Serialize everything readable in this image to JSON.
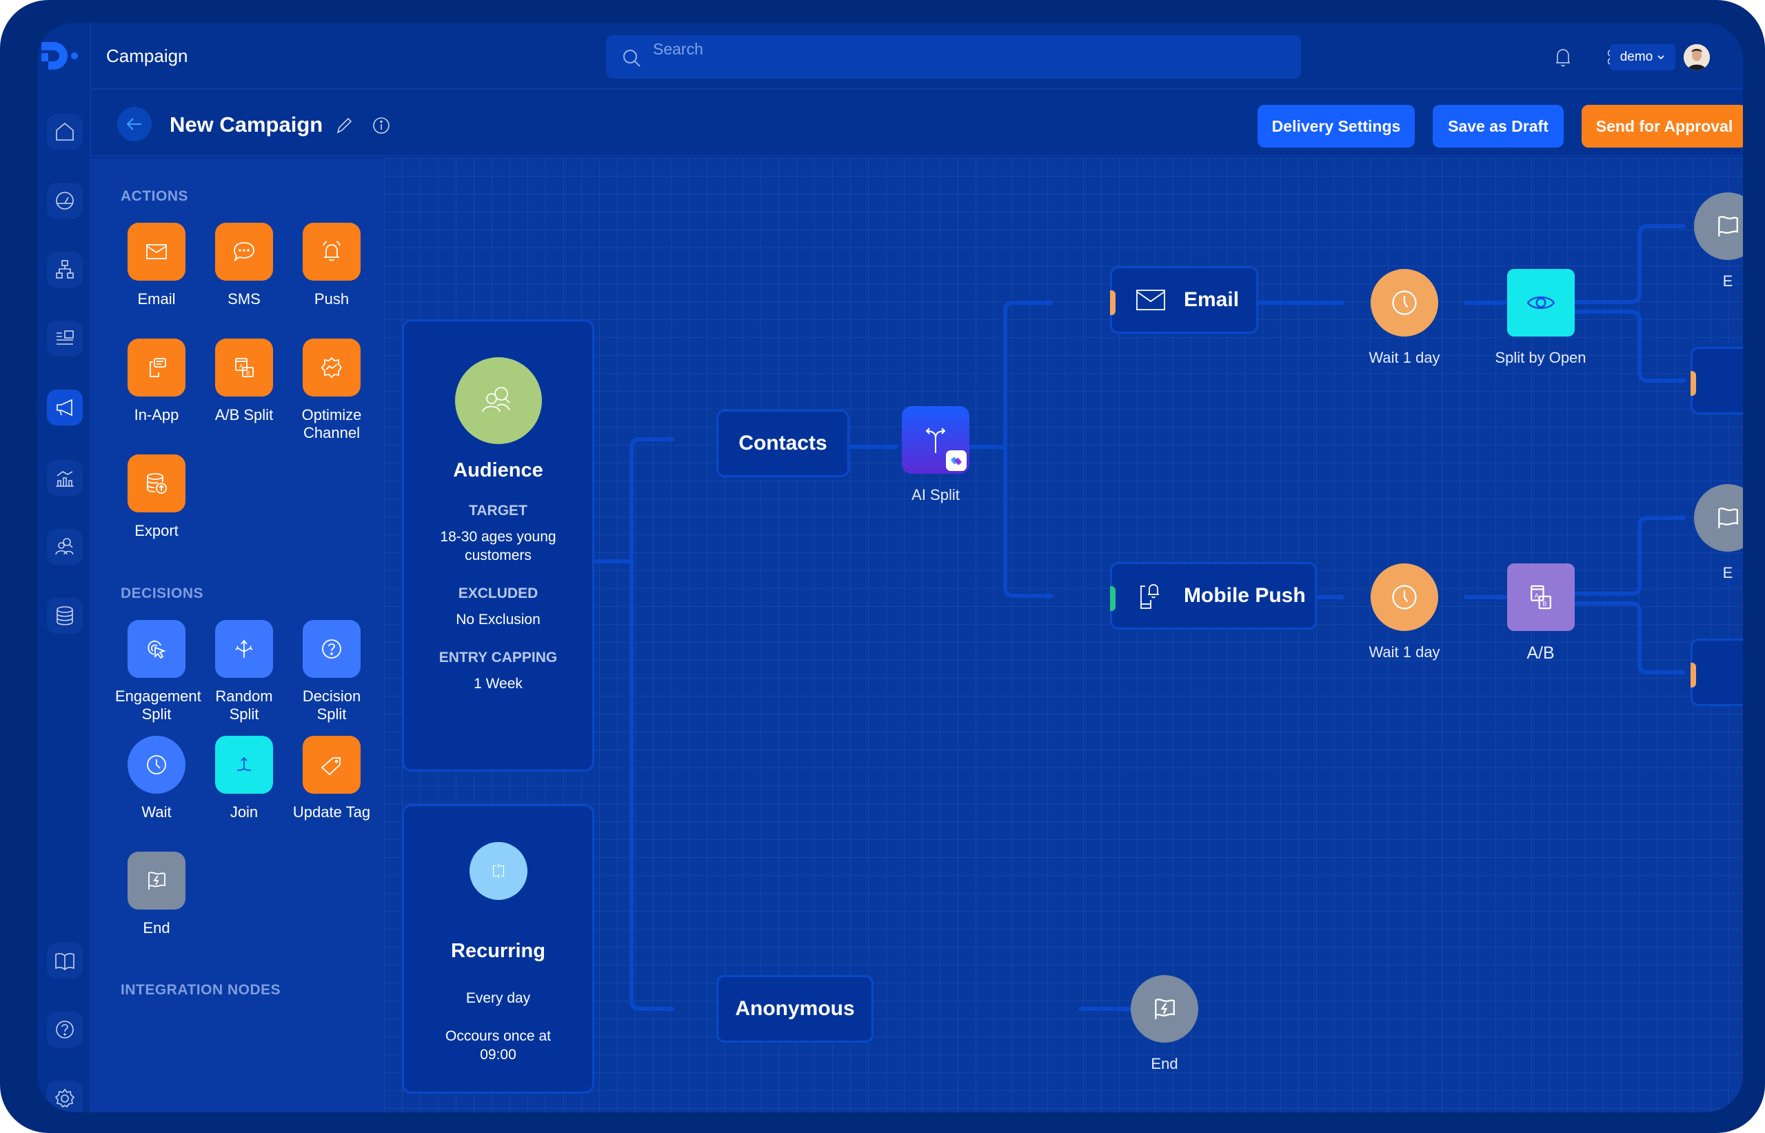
{
  "app": {
    "title": "Campaign",
    "search_placeholder": "Search",
    "user_menu_label": "demo",
    "icons": {
      "logo": "brand-logo",
      "notifications": "bell-icon",
      "apps": "apps-grid-icon",
      "avatar": "user-avatar"
    }
  },
  "rail": {
    "top_items": [
      {
        "name": "home",
        "icon": "home-icon",
        "active": false
      },
      {
        "name": "dashboard",
        "icon": "gauge-icon",
        "active": false
      },
      {
        "name": "hierarchy",
        "icon": "sitemap-icon",
        "active": false
      },
      {
        "name": "content",
        "icon": "layout-list-icon",
        "active": false
      },
      {
        "name": "campaigns",
        "icon": "megaphone-icon",
        "active": true
      },
      {
        "name": "analytics",
        "icon": "chart-icon",
        "active": false
      },
      {
        "name": "audiences",
        "icon": "users-search-icon",
        "active": false
      },
      {
        "name": "data",
        "icon": "database-icon",
        "active": false
      }
    ],
    "bottom_items": [
      {
        "name": "docs",
        "icon": "book-icon"
      },
      {
        "name": "help",
        "icon": "help-icon"
      },
      {
        "name": "settings",
        "icon": "gear-icon"
      }
    ]
  },
  "campaign": {
    "name": "New Campaign",
    "actions": {
      "delivery_settings": "Delivery Settings",
      "save_draft": "Save as Draft",
      "send_approval": "Send for Approval"
    }
  },
  "palette": {
    "sections": {
      "actions": "ACTIONS",
      "decisions": "DECISIONS",
      "integrations": "INTEGRATION NODES"
    },
    "actions": [
      {
        "label": "Email",
        "icon": "envelope-icon",
        "color": "#fb8019"
      },
      {
        "label": "SMS",
        "icon": "chat-bubble-icon",
        "color": "#fb8019"
      },
      {
        "label": "Push",
        "icon": "alarm-bell-icon",
        "color": "#fb8019"
      },
      {
        "label": "In-App",
        "icon": "phone-message-icon",
        "color": "#fb8019"
      },
      {
        "label": "A/B Split",
        "icon": "ab-split-icon",
        "color": "#fb8019"
      },
      {
        "label": "Optimize Channel",
        "icon": "optimize-badge-icon",
        "color": "#fb8019"
      },
      {
        "label": "Export",
        "icon": "database-export-icon",
        "color": "#fb8019"
      }
    ],
    "decisions": [
      {
        "label": "Engagement Split",
        "icon": "click-pointer-icon",
        "color": "#3b78ff"
      },
      {
        "label": "Random Split",
        "icon": "random-arrows-icon",
        "color": "#3b78ff"
      },
      {
        "label": "Decision Split",
        "icon": "question-circle-icon",
        "color": "#3b78ff"
      },
      {
        "label": "Wait",
        "icon": "clock-icon",
        "color": "#3b78ff"
      },
      {
        "label": "Join",
        "icon": "merge-icon",
        "color": "#14e8ec"
      },
      {
        "label": "Update Tag",
        "icon": "tag-icon",
        "color": "#fb8019"
      },
      {
        "label": "End",
        "icon": "flag-bolt-icon",
        "color": "#7c8ba0"
      }
    ]
  },
  "flow": {
    "audience": {
      "title": "Audience",
      "icon": "audience-search-icon",
      "color": "#a9cd7c",
      "fields": [
        {
          "key": "TARGET",
          "value": "18-30 ages young customers"
        },
        {
          "key": "EXCLUDED",
          "value": "No Exclusion"
        },
        {
          "key": "ENTRY CAPPING",
          "value": "1 Week"
        }
      ]
    },
    "recurring": {
      "title": "Recurring",
      "icon": "repeat-icon",
      "color": "#8ed0fb",
      "schedule": "Every day",
      "occurrence": "Occours once at 09:00"
    },
    "nodes": {
      "contacts": "Contacts",
      "ai_split": "AI Split",
      "anonymous": "Anonymous",
      "end": "End",
      "email": "Email",
      "mobile_push": "Mobile Push",
      "wait_email": "Wait 1 day",
      "split_by_open": "Split by Open",
      "wait_push": "Wait 1 day",
      "ab": "A/B",
      "end_partial": "E"
    },
    "colors": {
      "wait": "#f2a65e",
      "split_by_open": "#14e8ec",
      "ab": "#9378d6",
      "end": "#7c8ba0",
      "email_stripe": "#f2a65e",
      "push_stripe": "#27c48a",
      "edge": "#0a48c8"
    }
  }
}
